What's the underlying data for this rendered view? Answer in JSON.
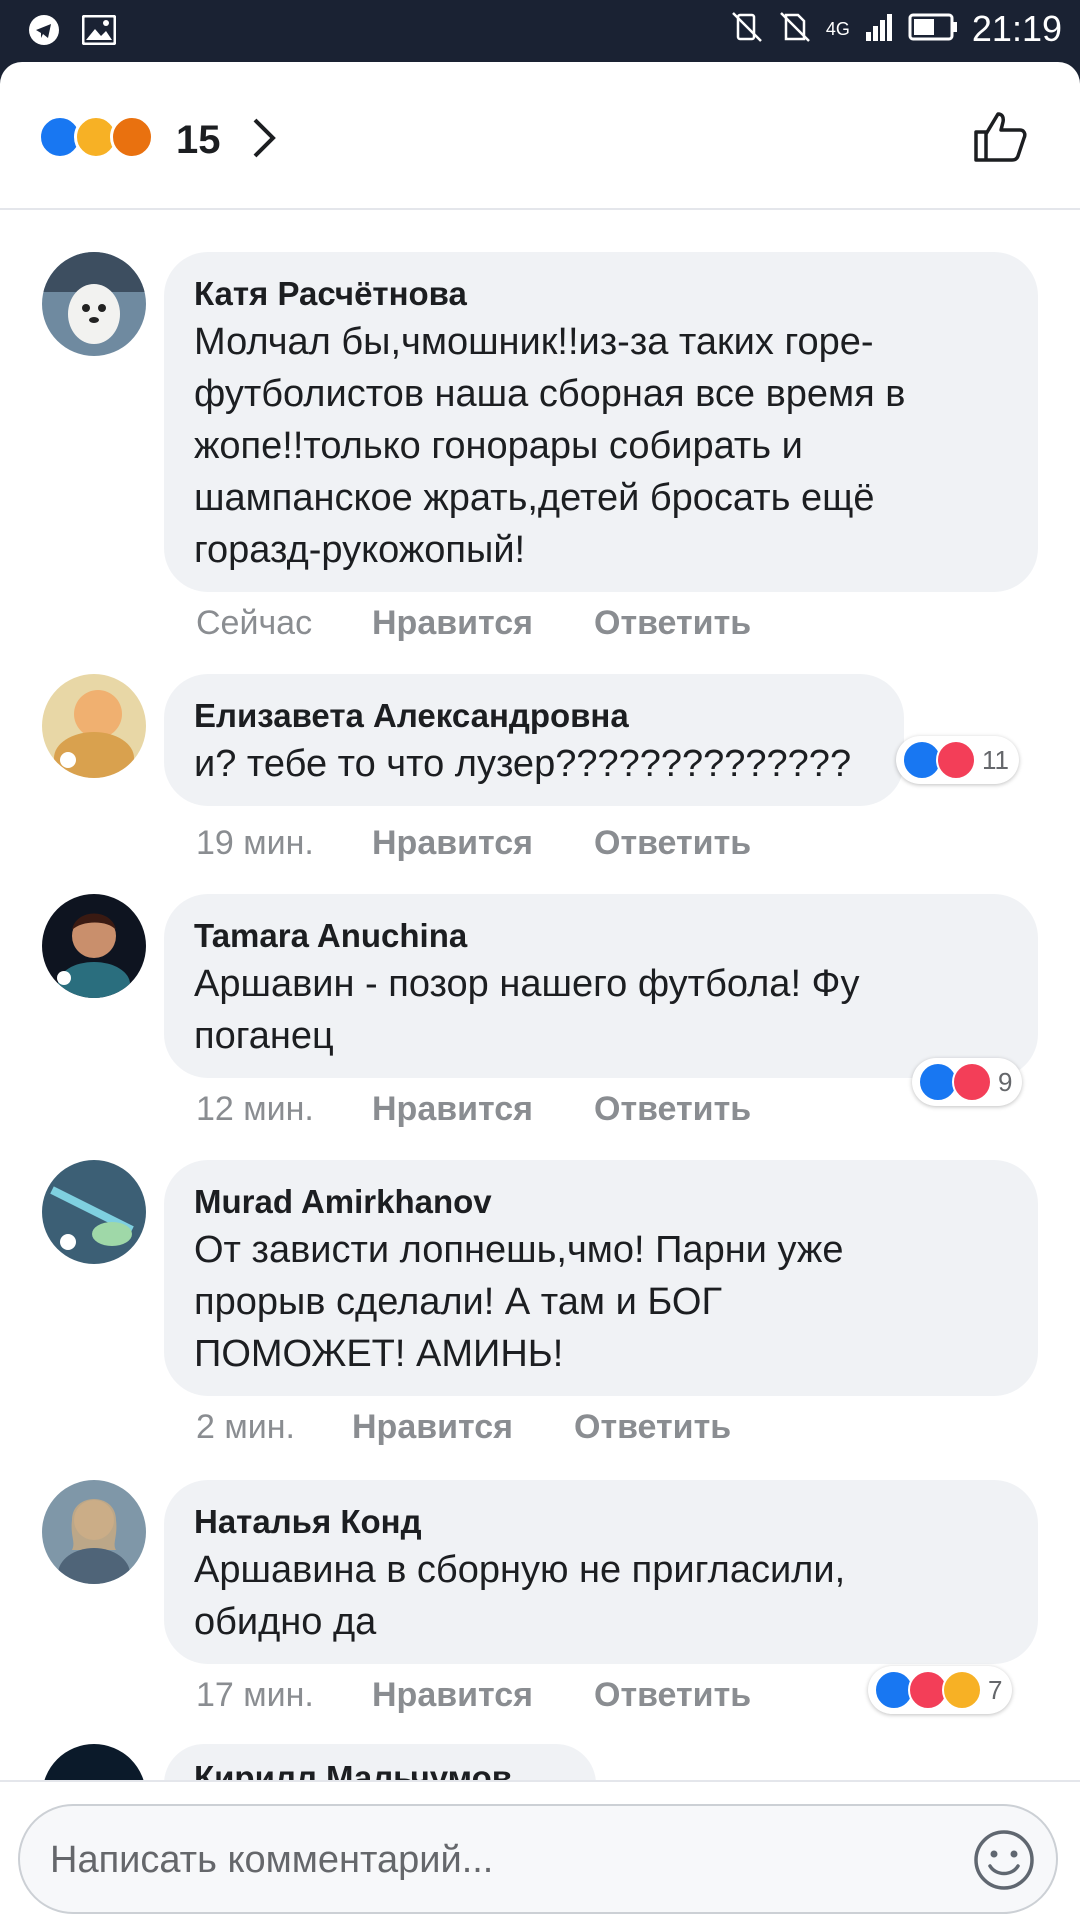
{
  "status_bar": {
    "time": "21:19",
    "network": "4G",
    "icons": [
      "telegram-icon",
      "gallery-icon",
      "mute-icon",
      "no-sim-icon",
      "signal-icon",
      "battery-icon"
    ]
  },
  "reactions_header": {
    "count": "15",
    "icons": [
      "like",
      "haha",
      "angry"
    ]
  },
  "comments": [
    {
      "author": "Катя Расчётнова",
      "text": "Молчал бы,чмошник!!из-за таких горе-\nфутболистов наша сборная все время в\nжопе!!только гонорары собирать и\nшампанское жрать,детей бросать ещё\nгоразд-рукожопый!",
      "time": "Сейчас",
      "like_label": "Нравится",
      "reply_label": "Ответить",
      "reaction_count": ""
    },
    {
      "author": "Елизавета Александровна",
      "text": "и? тебе то что лузер??????????????",
      "time": "19 мин.",
      "like_label": "Нравится",
      "reply_label": "Ответить",
      "reaction_count": "11",
      "reactions": [
        "like",
        "love"
      ]
    },
    {
      "author": "Tamara Anuchina",
      "text": "Аршавин - позор нашего футбола! Фу\nпоганец",
      "time": "12 мин.",
      "like_label": "Нравится",
      "reply_label": "Ответить",
      "reaction_count": "9",
      "reactions": [
        "like",
        "love"
      ]
    },
    {
      "author": "Murad Amirkhanov",
      "text": "От зависти лопнешь,чмо! Парни уже\nпрорыв сделали! А там и БОГ\nПОМОЖЕТ! АМИНЬ!",
      "time": "2 мин.",
      "like_label": "Нравится",
      "reply_label": "Ответить",
      "reaction_count": ""
    },
    {
      "author": "Наталья Конд",
      "text": "Аршавина в сборную не пригласили,\nобидно да",
      "time": "17 мин.",
      "like_label": "Нравится",
      "reply_label": "Ответить",
      "reaction_count": "7",
      "reactions": [
        "like",
        "love",
        "haha"
      ]
    },
    {
      "author": "Кирилл Мальчумов"
    }
  ],
  "composer": {
    "placeholder": "Написать комментарий..."
  },
  "colors": {
    "like": "#1877f2",
    "love": "#f33e58",
    "haha": "#f7b125",
    "angry": "#e9710f",
    "bubble": "#f0f2f5"
  }
}
